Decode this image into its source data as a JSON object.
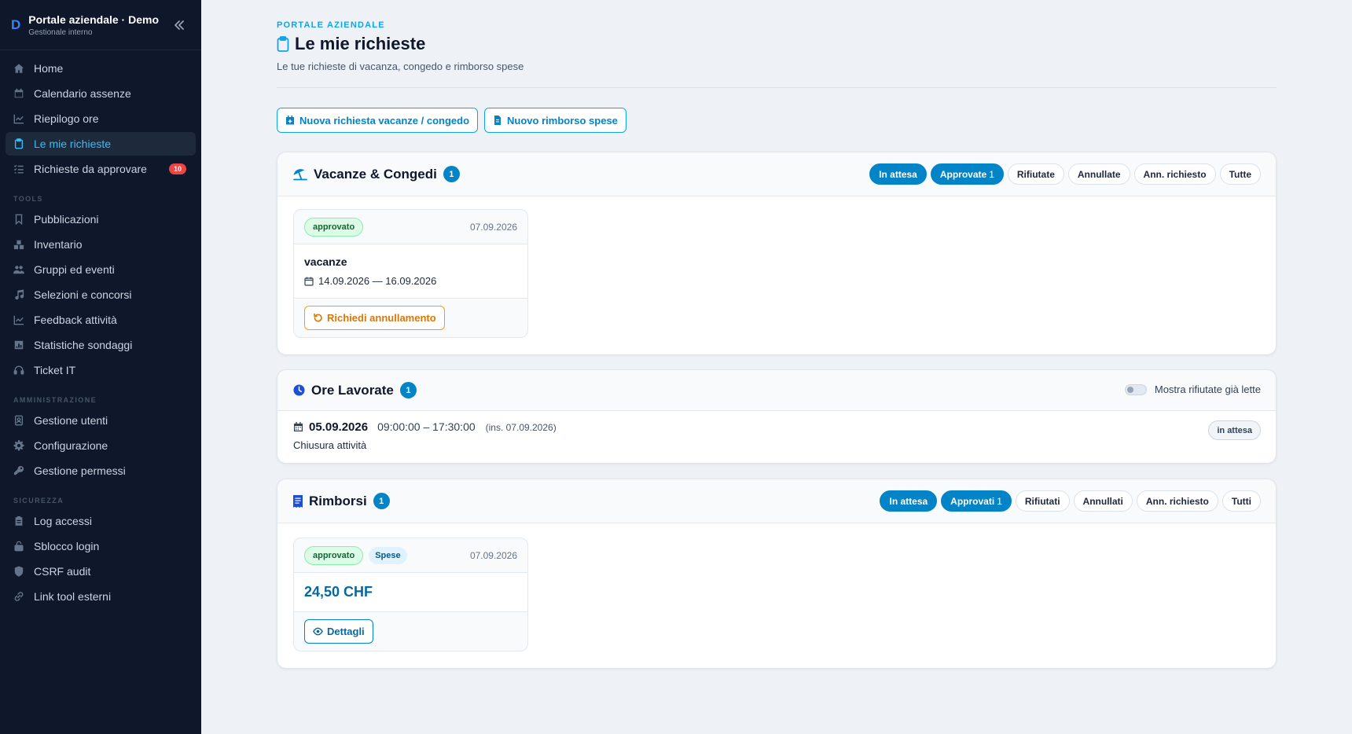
{
  "brand": {
    "logo": "D",
    "title": "Portale aziendale · Demo",
    "subtitle": "Gestionale interno"
  },
  "sidebar": {
    "items": [
      {
        "label": "Home",
        "icon": "home-icon"
      },
      {
        "label": "Calendario assenze",
        "icon": "calendar-icon"
      },
      {
        "label": "Riepilogo ore",
        "icon": "chart-line-icon"
      },
      {
        "label": "Le mie richieste",
        "icon": "clipboard-icon",
        "active": true
      },
      {
        "label": "Richieste da approvare",
        "icon": "list-check-icon",
        "badge": "10"
      }
    ],
    "tools_label": "TOOLS",
    "tools": [
      {
        "label": "Pubblicazioni",
        "icon": "bookmark-icon"
      },
      {
        "label": "Inventario",
        "icon": "boxes-icon"
      },
      {
        "label": "Gruppi ed eventi",
        "icon": "people-icon"
      },
      {
        "label": "Selezioni e concorsi",
        "icon": "music-icon"
      },
      {
        "label": "Feedback attività",
        "icon": "chart-line-icon"
      },
      {
        "label": "Statistiche sondaggi",
        "icon": "poll-icon"
      },
      {
        "label": "Ticket IT",
        "icon": "headset-icon"
      }
    ],
    "admin_label": "AMMINISTRAZIONE",
    "admin": [
      {
        "label": "Gestione utenti",
        "icon": "user-icon"
      },
      {
        "label": "Configurazione",
        "icon": "gear-icon"
      },
      {
        "label": "Gestione permessi",
        "icon": "key-icon"
      }
    ],
    "security_label": "SICUREZZA",
    "security": [
      {
        "label": "Log accessi",
        "icon": "clipboard-icon"
      },
      {
        "label": "Sblocco login",
        "icon": "unlock-icon"
      },
      {
        "label": "CSRF audit",
        "icon": "shield-icon"
      },
      {
        "label": "Link tool esterni",
        "icon": "link-icon"
      }
    ]
  },
  "header": {
    "eyebrow": "PORTALE AZIENDALE",
    "title": "Le mie richieste",
    "subtitle": "Le tue richieste di vacanza, congedo e rimborso spese"
  },
  "actions": {
    "new_leave": "Nuova richiesta vacanze / congedo",
    "new_expense": "Nuovo rimborso spese"
  },
  "leave": {
    "title": "Vacanze & Congedi",
    "count": "1",
    "filters": [
      {
        "label": "In attesa",
        "on": true
      },
      {
        "label": "Approvate",
        "count": "1",
        "on": true
      },
      {
        "label": "Rifiutate"
      },
      {
        "label": "Annullate"
      },
      {
        "label": "Ann. richiesto"
      },
      {
        "label": "Tutte"
      }
    ],
    "card": {
      "status": "approvato",
      "date": "07.09.2026",
      "kind": "vacanze",
      "range": "14.09.2026 — 16.09.2026",
      "action": "Richiedi annullamento"
    }
  },
  "hours": {
    "title": "Ore Lavorate",
    "count": "1",
    "toggle_label": "Mostra rifiutate già lette",
    "row": {
      "date": "05.09.2026",
      "time": "09:00:00 – 17:30:00",
      "inserted": "(ins. 07.09.2026)",
      "note": "Chiusura attività",
      "status": "in attesa"
    }
  },
  "expenses": {
    "title": "Rimborsi",
    "count": "1",
    "filters": [
      {
        "label": "In attesa",
        "on": true
      },
      {
        "label": "Approvati",
        "count": "1",
        "on": true
      },
      {
        "label": "Rifiutati"
      },
      {
        "label": "Annullati"
      },
      {
        "label": "Ann. richiesto"
      },
      {
        "label": "Tutti"
      }
    ],
    "card": {
      "status": "approvato",
      "type": "Spese",
      "date": "07.09.2026",
      "amount": "24,50 CHF",
      "action": "Dettagli"
    }
  },
  "colors": {
    "accent": "#0284c7",
    "sidebar_bg": "#0f172a",
    "success": "#dcfce7",
    "warning": "#f59e0b",
    "danger": "#ef4444"
  }
}
